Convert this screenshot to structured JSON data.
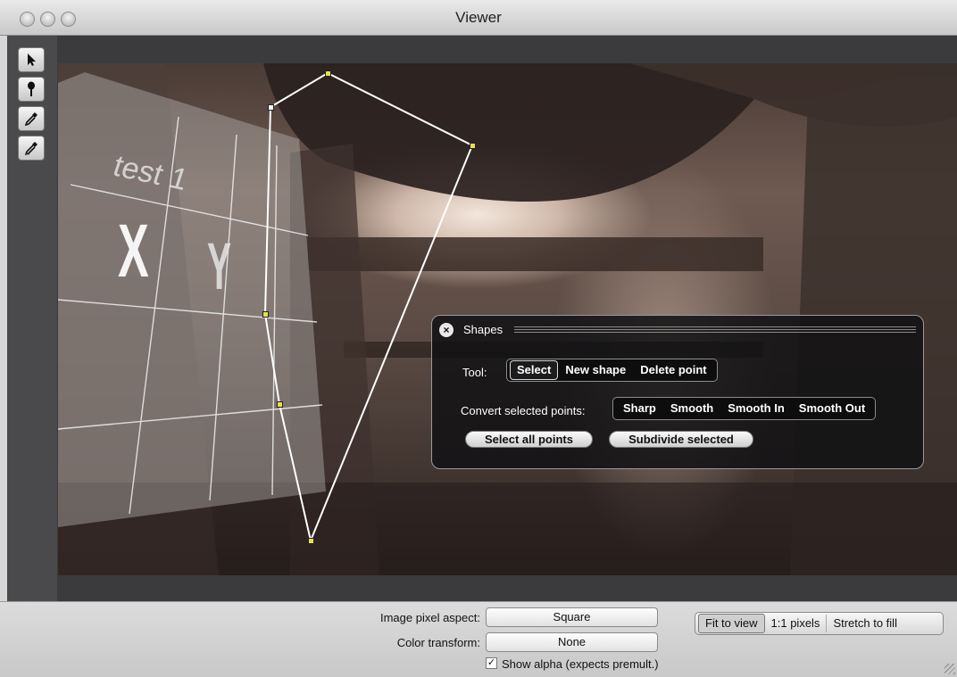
{
  "window": {
    "title": "Viewer"
  },
  "tools": [
    {
      "name": "select-arrow-icon"
    },
    {
      "name": "paint-brush-icon"
    },
    {
      "name": "eyedropper-icon"
    },
    {
      "name": "eyedropper-alt-icon"
    }
  ],
  "overlay": {
    "heading": "test 1",
    "letters": [
      "X",
      "Y"
    ]
  },
  "shapes_panel": {
    "title": "Shapes",
    "close_icon": "×",
    "tool_label": "Tool:",
    "tool_options": [
      "Select",
      "New shape",
      "Delete point"
    ],
    "tool_selected": "Select",
    "convert_label": "Convert selected points:",
    "convert_options": [
      "Sharp",
      "Smooth",
      "Smooth In",
      "Smooth Out"
    ],
    "select_all_label": "Select all points",
    "subdivide_label": "Subdivide selected"
  },
  "bottom": {
    "pixel_aspect_label": "Image pixel aspect:",
    "pixel_aspect_value": "Square",
    "color_transform_label": "Color transform:",
    "color_transform_value": "None",
    "show_alpha_label": "Show alpha (expects premult.)",
    "show_alpha_checked": true,
    "view_options": [
      "Fit to view",
      "1:1 pixels",
      "Stretch to fill"
    ],
    "view_selected": "Fit to view"
  },
  "colors": {
    "panel_bg": "#121214",
    "workspace": "#3b3b3d",
    "shape_point": "#e8e04a"
  }
}
